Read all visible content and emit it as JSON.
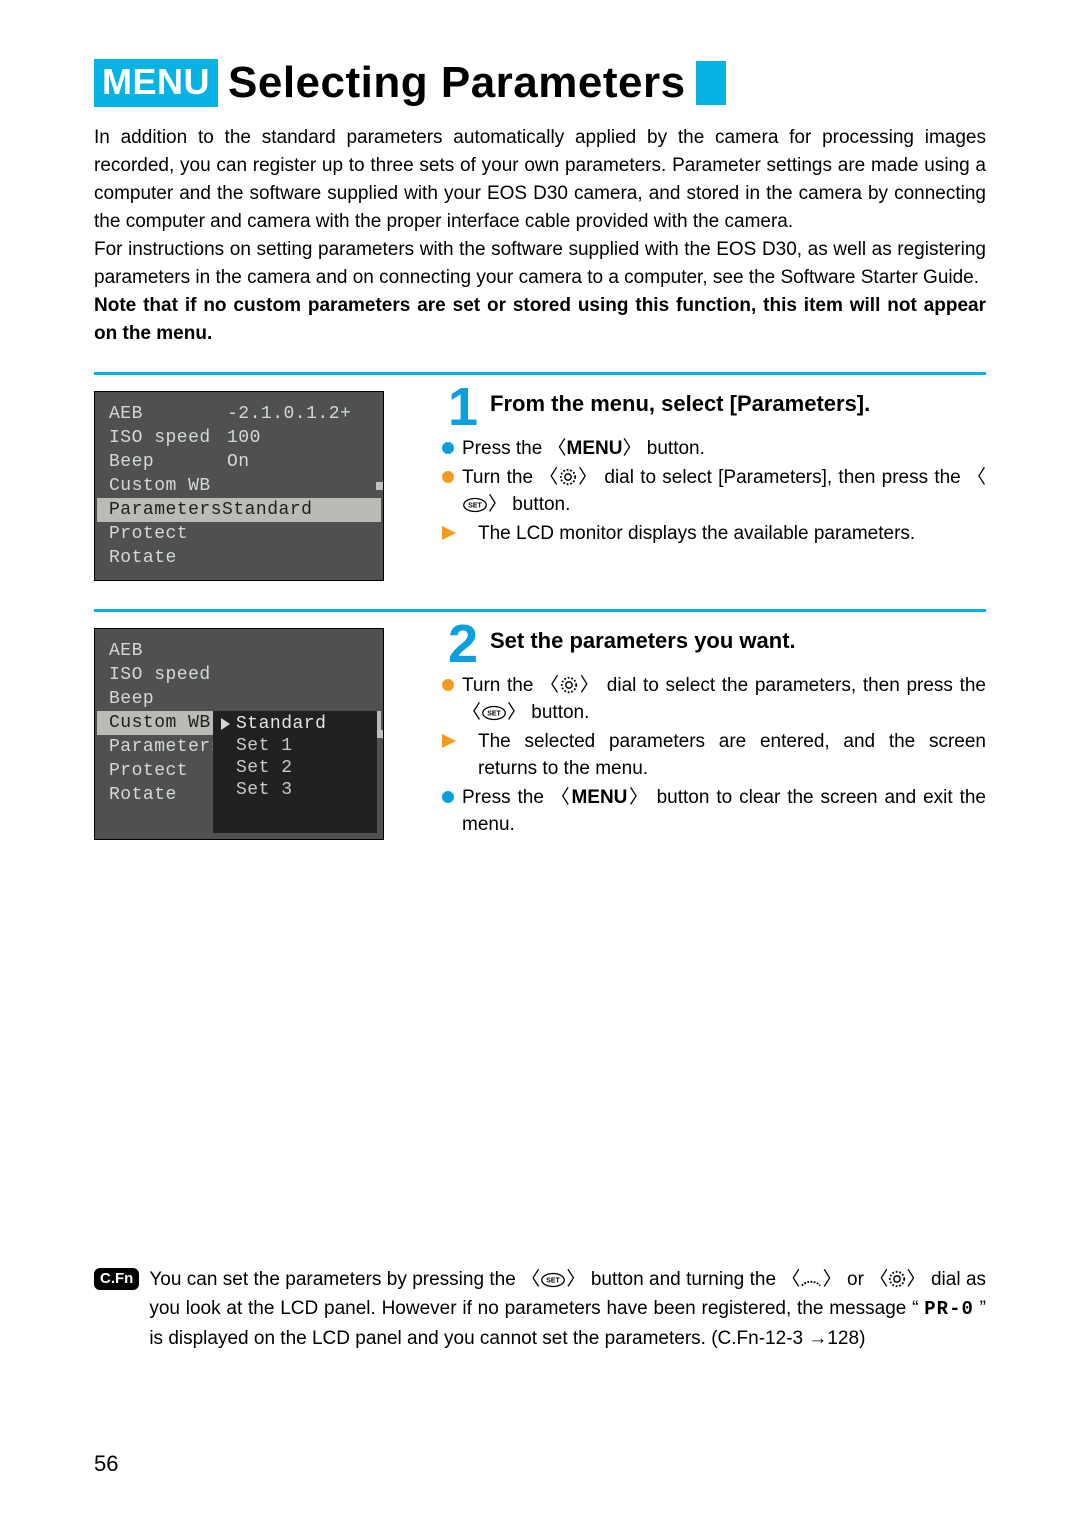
{
  "header": {
    "menu_label": "MENU",
    "title": "Selecting Parameters"
  },
  "intro": {
    "p1": "In addition to the standard parameters automatically applied by the camera for processing images recorded, you can register up to three sets of your own parameters. Parameter settings are made using a computer and the software supplied with your EOS D30 camera, and stored in the camera by connecting the computer and camera with the proper interface cable provided with the camera.",
    "p2": "For instructions on setting parameters with the software supplied with the EOS D30, as well as registering parameters in the camera and on connecting your camera to a computer, see the Software Starter Guide.",
    "p3": "Note that if no custom parameters are set or stored using this function, this item will not appear on the menu."
  },
  "lcd1": {
    "rows": [
      {
        "label": "AEB",
        "value": "-2.1.0.1.2+"
      },
      {
        "label": "ISO speed",
        "value": "100"
      },
      {
        "label": "Beep",
        "value": "On"
      },
      {
        "label": "Custom WB",
        "value": ""
      },
      {
        "label": "Parameters",
        "value": "Standard",
        "hl": true
      },
      {
        "label": "Protect",
        "value": ""
      },
      {
        "label": "Rotate",
        "value": ""
      }
    ]
  },
  "lcd2": {
    "rows": [
      {
        "label": "AEB",
        "value": ""
      },
      {
        "label": "ISO speed",
        "value": ""
      },
      {
        "label": "Beep",
        "value": ""
      },
      {
        "label": "Custom WB",
        "value": "",
        "hl": true
      },
      {
        "label": "Parameters",
        "value": ""
      },
      {
        "label": "Protect",
        "value": ""
      },
      {
        "label": "Rotate",
        "value": ""
      }
    ],
    "submenu": [
      "Standard",
      "Set 1",
      "Set 2",
      "Set 3"
    ]
  },
  "step1": {
    "num": "1",
    "title": "From the menu, select [Parameters].",
    "l1a": "Press the 〈",
    "l1b": "MENU",
    "l1c": "〉 button.",
    "l2a": "Turn the 〈",
    "l2b": "〉 dial to select [Parameters], then press the 〈",
    "l2c": "〉 button.",
    "l3": "The LCD monitor displays the available parameters."
  },
  "step2": {
    "num": "2",
    "title": "Set the parameters you want.",
    "l1a": "Turn the 〈",
    "l1b": "〉 dial to select the parameters, then press the 〈",
    "l1c": "〉 button.",
    "l2": "The selected parameters are entered, and the screen returns to the menu.",
    "l3a": "Press the 〈",
    "l3b": "MENU",
    "l3c": "〉 button to clear the screen and exit the menu."
  },
  "footer": {
    "badge": "C.Fn",
    "t1": "You can set the parameters by pressing the 〈",
    "t2": "〉 button and turning the 〈",
    "t3": "〉 or 〈",
    "t4": "〉 dial as you look at the LCD panel. However if no parameters have been registered, the message “ ",
    "pr": "PR-0",
    "t5": " ” is displayed on the LCD panel and you cannot set the parameters. (C.Fn-12-3 →128)"
  },
  "page_number": "56"
}
